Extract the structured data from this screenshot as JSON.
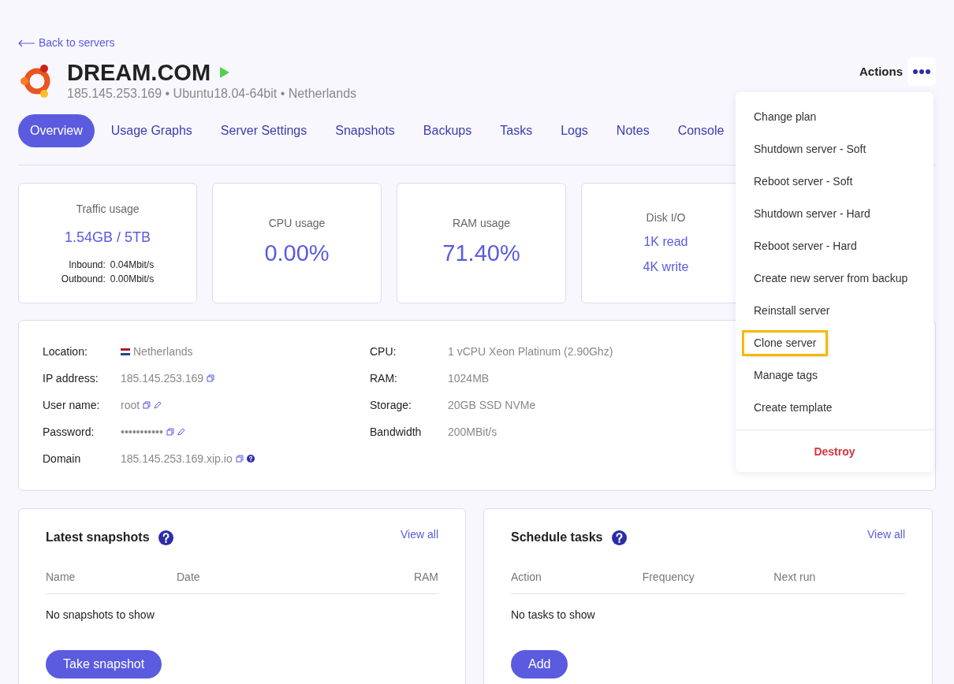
{
  "back_link": "Back to servers",
  "server": {
    "name": "DREAM.COM",
    "running": true,
    "subtitle": "185.145.253.169 • Ubuntu18.04-64bit • Netherlands"
  },
  "actions": {
    "label": "Actions"
  },
  "tabs": [
    {
      "label": "Overview",
      "selected": true
    },
    {
      "label": "Usage Graphs",
      "selected": false
    },
    {
      "label": "Server Settings",
      "selected": false
    },
    {
      "label": "Snapshots",
      "selected": false
    },
    {
      "label": "Backups",
      "selected": false
    },
    {
      "label": "Tasks",
      "selected": false
    },
    {
      "label": "Logs",
      "selected": false
    },
    {
      "label": "Notes",
      "selected": false
    },
    {
      "label": "Console",
      "selected": false
    }
  ],
  "stats": [
    {
      "kind": "traffic",
      "title": "Traffic usage",
      "value": "1.54GB / 5TB",
      "rows": [
        {
          "label": "Inbound:",
          "value": "0.04Mbit/s"
        },
        {
          "label": "Outbound:",
          "value": "0.00Mbit/s"
        }
      ]
    },
    {
      "kind": "big",
      "title": "CPU usage",
      "value": "0.00%"
    },
    {
      "kind": "big",
      "title": "RAM usage",
      "value": "71.40%"
    },
    {
      "kind": "disk",
      "title": "Disk I/O",
      "lines": [
        "1K read",
        "4K write"
      ]
    }
  ],
  "details": {
    "left": [
      {
        "label": "Location:",
        "value": "Netherlands",
        "flag": true
      },
      {
        "label": "IP address:",
        "value": "185.145.253.169",
        "icons": [
          {
            "kind": "copy"
          }
        ]
      },
      {
        "label": "User name:",
        "value": "root",
        "icons": [
          {
            "kind": "copy"
          },
          {
            "kind": "edit"
          }
        ]
      },
      {
        "label": "Password:",
        "value": "•••••••••••",
        "icons": [
          {
            "kind": "copy"
          },
          {
            "kind": "edit"
          }
        ]
      },
      {
        "label": "Domain",
        "value": "185.145.253.169.xip.io",
        "icons": [
          {
            "kind": "copy"
          },
          {
            "kind": "help"
          }
        ]
      }
    ],
    "middle": [
      {
        "label": "CPU:",
        "value": "1 vCPU Xeon Platinum (2.90Ghz)"
      },
      {
        "label": "RAM:",
        "value": "1024MB"
      },
      {
        "label": "Storage:",
        "value": "20GB SSD NVMe"
      },
      {
        "label": "Bandwidth",
        "value": "200MBit/s"
      }
    ]
  },
  "menu": [
    {
      "label": "Change plan",
      "kind": "item",
      "highlighted": false
    },
    {
      "label": "Shutdown server - Soft",
      "kind": "item",
      "highlighted": false
    },
    {
      "label": "Reboot server - Soft",
      "kind": "item",
      "highlighted": false
    },
    {
      "label": "Shutdown server - Hard",
      "kind": "item",
      "highlighted": false
    },
    {
      "label": "Reboot server - Hard",
      "kind": "item",
      "highlighted": false
    },
    {
      "label": "Create new server from backup",
      "kind": "item",
      "highlighted": false
    },
    {
      "label": "Reinstall server",
      "kind": "item",
      "highlighted": false
    },
    {
      "label": "Clone server",
      "kind": "item",
      "highlighted": true
    },
    {
      "label": "Manage tags",
      "kind": "item",
      "highlighted": false
    },
    {
      "label": "Create template",
      "kind": "item",
      "highlighted": false
    },
    {
      "label": "Destroy",
      "kind": "danger",
      "highlighted": false
    }
  ],
  "panels": [
    {
      "title": "Latest snapshots",
      "view_all": "View all",
      "columns": [
        "Name",
        "Date",
        "RAM"
      ],
      "empty": "No snapshots to show",
      "button": "Take snapshot"
    },
    {
      "title": "Schedule tasks",
      "view_all": "View all",
      "columns": [
        "Action",
        "Frequency",
        "Next run"
      ],
      "empty": "No tasks to show",
      "button": "Add"
    }
  ]
}
